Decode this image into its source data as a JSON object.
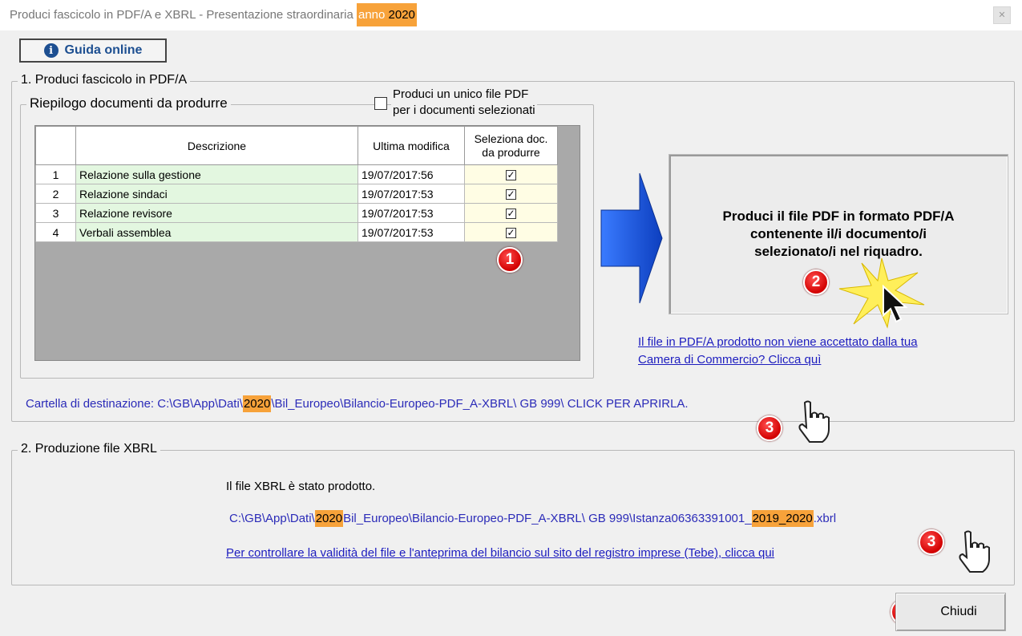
{
  "window": {
    "title": "Produci fascicolo in PDF/A e XBRL - Presentazione straordinaria",
    "title_highlight_anno": "anno",
    "title_highlight_year": "2020",
    "close_glyph": "✕"
  },
  "guida": {
    "label": "Guida online",
    "icon": "info-icon"
  },
  "section1": {
    "label": "1. Produci fascicolo in PDF/A",
    "riepilogo_label": "Riepilogo documenti da produrre",
    "single_pdf_line1": "Produci un unico file PDF",
    "single_pdf_line2": "per i documenti selezionati",
    "columns": [
      "",
      "Descrizione",
      "Ultima modifica",
      "Seleziona doc.",
      "da produrre"
    ],
    "rows": [
      {
        "num": "1",
        "desc": "Relazione sulla gestione",
        "date": "19/07/2017:56",
        "checked": "✓"
      },
      {
        "num": "2",
        "desc": "Relazione sindaci",
        "date": "19/07/2017:53",
        "checked": "✓"
      },
      {
        "num": "3",
        "desc": "Relazione revisore",
        "date": "19/07/2017:53",
        "checked": "✓"
      },
      {
        "num": "4",
        "desc": "Verbali assemblea",
        "date": "19/07/2017:53",
        "checked": "✓"
      }
    ],
    "produce_btn_line1": "Produci il file PDF in formato PDF/A",
    "produce_btn_line2": "contenente il/i documento/i",
    "produce_btn_line3": "selezionato/i nel riquadro.",
    "help_link_line1": "Il file in PDF/A prodotto non viene accettato dalla tua",
    "help_link_line2": "Camera di Commercio? Clicca quì",
    "dest_prefix": "Cartella di destinazione: C:\\GB\\App\\Dati\\",
    "dest_year": "2020",
    "dest_suffix": "\\Bil_Europeo\\Bilancio-Europeo-PDF_A-XBRL\\  GB 999\\ CLICK PER APRIRLA."
  },
  "section2": {
    "label": "2. Produzione file XBRL",
    "status": "Il file XBRL  è stato prodotto.",
    "path_prefix": "C:\\GB\\App\\Dati\\",
    "path_year": "2020",
    "path_mid": "Bil_Europeo\\Bilancio-Europeo-PDF_A-XBRL\\  GB 999\\Istanza06363391001_",
    "path_period": "2019_2020",
    "path_ext": ".xbrl",
    "check_link": "Per controllare la validità del file e l'anteprima del bilancio sul sito del registro imprese (Tebe), clicca qui"
  },
  "badges": [
    "1",
    "2",
    "3",
    "3",
    "4"
  ],
  "close_button": {
    "label": "Chiudi"
  },
  "colors": {
    "highlight": "#f7a23a",
    "link": "#1d1dbf",
    "badge": "#d20000",
    "arrow": "#1f5fe0"
  }
}
